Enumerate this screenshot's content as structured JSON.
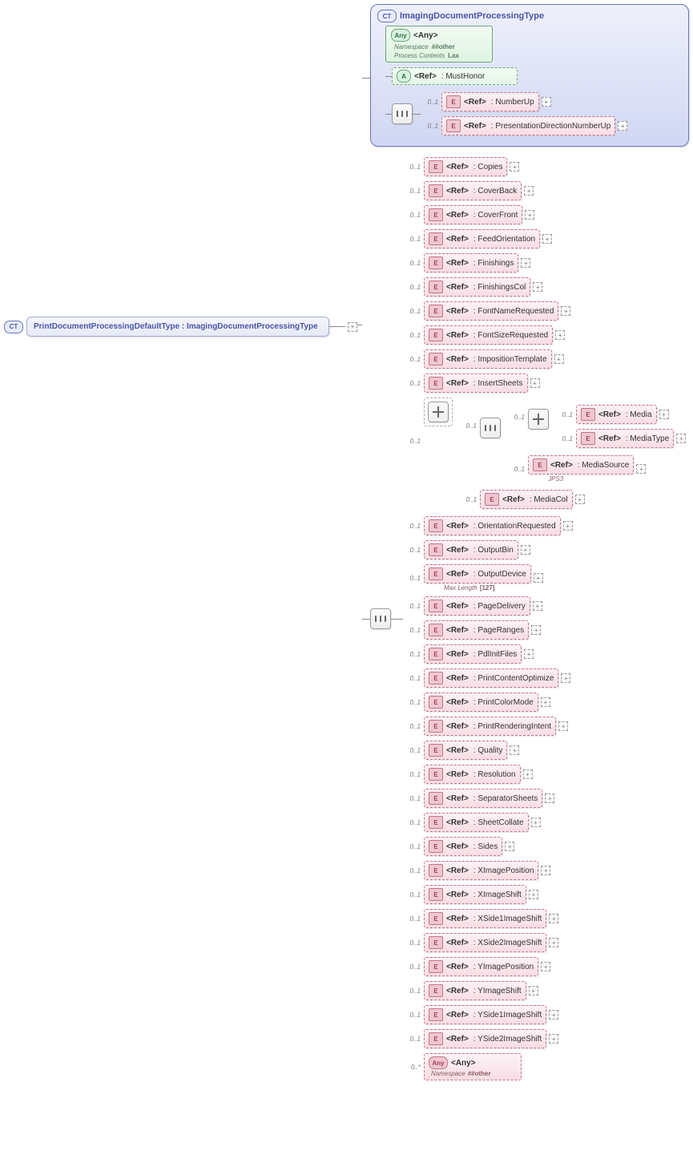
{
  "root": {
    "badge": "CT",
    "name": "PrintDocumentProcessingDefaultType",
    "base": "ImagingDocumentProcessingType"
  },
  "complexType": {
    "badge": "CT",
    "title": "ImagingDocumentProcessingType",
    "any": {
      "badge": "Any",
      "label": "<Any>",
      "nsLabel": "Namespace",
      "nsValue": "##other",
      "pcLabel": "Process Contents",
      "pcValue": "Lax"
    },
    "attribute": {
      "badge": "A",
      "ref": "<Ref>",
      "type": ": MustHonor"
    },
    "nested": {
      "card": "0..1",
      "items": [
        {
          "card": "0..1",
          "ref": "<Ref>",
          "type": ": NumberUp"
        },
        {
          "card": "0..1",
          "ref": "<Ref>",
          "type": ": PresentationDirectionNumberUp"
        }
      ]
    }
  },
  "main": {
    "card": "0..1",
    "refText": "<Ref>",
    "items": [
      {
        "type": ": Copies"
      },
      {
        "type": ": CoverBack"
      },
      {
        "type": ": CoverFront"
      },
      {
        "type": ": FeedOrientation"
      },
      {
        "type": ": Finishings"
      },
      {
        "type": ": FinishingsCol"
      },
      {
        "type": ": FontNameRequested"
      },
      {
        "type": ": FontSizeRequested"
      },
      {
        "type": ": ImpositionTemplate"
      },
      {
        "type": ": InsertSheets"
      }
    ],
    "mediaGroup": {
      "choiceCard": "0..1",
      "choiceA": {
        "seqCard": "0..1",
        "innerCard": "0..1",
        "media": {
          "ref": "<Ref>",
          "type": ": Media"
        },
        "mediaType": {
          "ref": "<Ref>",
          "type": ": MediaType"
        },
        "mediaSource": {
          "ref": "<Ref>",
          "type": ": MediaSource",
          "metaLabel": "JPS3"
        }
      },
      "mediaCol": {
        "card": "0..1",
        "ref": "<Ref>",
        "type": ": MediaCol"
      }
    },
    "items2": [
      {
        "type": ": OrientationRequested"
      },
      {
        "type": ": OutputBin"
      }
    ],
    "outputDevice": {
      "type": ": OutputDevice",
      "metaLabel": "Max Length",
      "metaValue": "[127]"
    },
    "items3": [
      {
        "type": ": PageDelivery"
      },
      {
        "type": ": PageRanges"
      },
      {
        "type": ": PdlInitFiles"
      },
      {
        "type": ": PrintContentOptimize"
      },
      {
        "type": ": PrintColorMode"
      },
      {
        "type": ": PrintRenderingIntent"
      },
      {
        "type": ": Quality"
      },
      {
        "type": ": Resolution"
      },
      {
        "type": ": SeparatorSheets"
      },
      {
        "type": ": SheetCollate"
      },
      {
        "type": ": Sides"
      },
      {
        "type": ": XImagePosition"
      },
      {
        "type": ": XImageShift"
      },
      {
        "type": ": XSide1ImageShift"
      },
      {
        "type": ": XSide2ImageShift"
      },
      {
        "type": ": YImagePosition"
      },
      {
        "type": ": YImageShift"
      },
      {
        "type": ": YSide1ImageShift"
      },
      {
        "type": ": YSide2ImageShift"
      }
    ],
    "anyElem": {
      "card": "0..*",
      "badge": "Any",
      "label": "<Any>",
      "nsLabel": "Namespace",
      "nsValue": "##other"
    }
  }
}
